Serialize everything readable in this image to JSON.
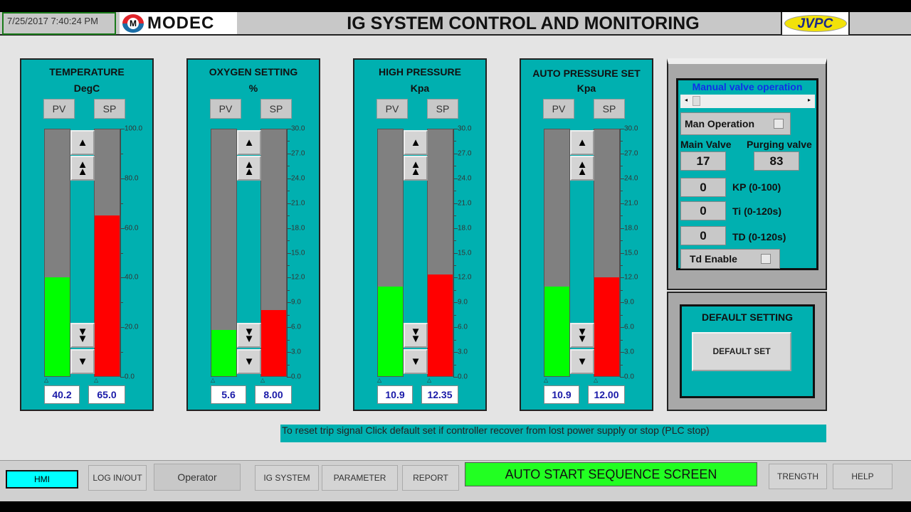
{
  "header": {
    "datetime": "7/25/2017 7:40:24 PM",
    "left_logo": "MODEC",
    "title": "IG SYSTEM CONTROL AND MONITORING",
    "right_logo": "JVPC"
  },
  "gauges": [
    {
      "title": "TEMPERATURE",
      "unit": "DegC",
      "pv_label": "PV",
      "sp_label": "SP",
      "pv": 40.2,
      "sp": 65.0,
      "pv_text": "40.2",
      "sp_text": "65.0",
      "max": 100,
      "ticks": [
        "100.0",
        "80.0",
        "60.0",
        "40.0",
        "20.0",
        "0.0"
      ]
    },
    {
      "title": "OXYGEN SETTING",
      "unit": "%",
      "pv_label": "PV",
      "sp_label": "SP",
      "pv": 5.6,
      "sp": 8.0,
      "pv_text": "5.6",
      "sp_text": "8.00",
      "max": 30,
      "ticks": [
        "30.0",
        "27.0",
        "24.0",
        "21.0",
        "18.0",
        "15.0",
        "12.0",
        "9.0",
        "6.0",
        "3.0",
        "0.0"
      ]
    },
    {
      "title": "HIGH PRESSURE",
      "unit": "Kpa",
      "pv_label": "PV",
      "sp_label": "SP",
      "pv": 10.9,
      "sp": 12.35,
      "pv_text": "10.9",
      "sp_text": "12.35",
      "max": 30,
      "ticks": [
        "30.0",
        "27.0",
        "24.0",
        "21.0",
        "18.0",
        "15.0",
        "12.0",
        "9.0",
        "6.0",
        "3.0",
        "0.0"
      ]
    },
    {
      "title": "AUTO PRESSURE SET",
      "unit": "Kpa",
      "pv_label": "PV",
      "sp_label": "SP",
      "pv": 10.9,
      "sp": 12.0,
      "pv_text": "10.9",
      "sp_text": "12.00",
      "max": 30,
      "ticks": [
        "30.0",
        "27.0",
        "24.0",
        "21.0",
        "18.0",
        "15.0",
        "12.0",
        "9.0",
        "6.0",
        "3.0",
        "0.0"
      ]
    }
  ],
  "colors": {
    "pv": "#00ff00",
    "sp": "#ff0000",
    "panel": "#00b0b0"
  },
  "manual": {
    "title": "Manual valve operation",
    "man_operation": "Man Operation",
    "main_valve_label": "Main Valve",
    "purging_valve_label": "Purging valve",
    "main_valve": "17",
    "purging_valve": "83",
    "kp": "0",
    "kp_label": "KP (0-100)",
    "ti": "0",
    "ti_label": "Ti (0-120s)",
    "td": "0",
    "td_label": "TD (0-120s)",
    "td_enable": "Td Enable"
  },
  "default": {
    "title": "DEFAULT SETTING",
    "button": "DEFAULT SET"
  },
  "message": "To reset trip signal Click default set if controller recover from lost power supply or stop (PLC stop)",
  "nav": {
    "hmi": "HMI",
    "login": "LOG IN/OUT",
    "operator": "Operator",
    "ig_system": "IG SYSTEM",
    "parameter": "PARAMETER",
    "report": "REPORT",
    "sequence": "AUTO START SEQUENCE SCREEN",
    "trength": "TRENGTH",
    "help": "HELP"
  }
}
